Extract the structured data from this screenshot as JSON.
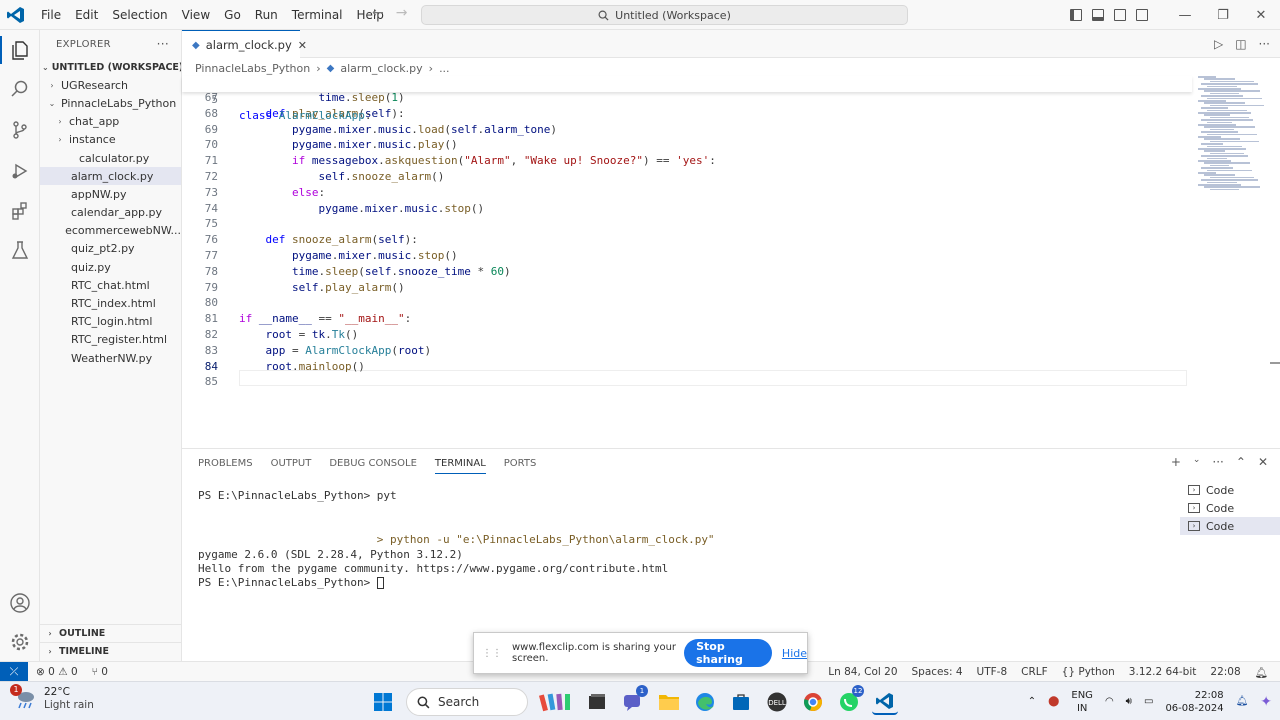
{
  "titlebar": {
    "menus": [
      "File",
      "Edit",
      "Selection",
      "View",
      "Go",
      "Run",
      "Terminal",
      "Help"
    ],
    "search_text": "Untitled (Workspace)"
  },
  "explorer": {
    "title": "EXPLORER",
    "more": "···",
    "workspace": "UNTITLED (WORKSPACE)",
    "tree": [
      {
        "label": "UGResearch",
        "indent": 1,
        "chevron": "›",
        "icon": ""
      },
      {
        "label": "PinnacleLabs_Python",
        "indent": 1,
        "chevron": "⌄",
        "icon": ""
      },
      {
        "label": "chat_app",
        "indent": 2,
        "chevron": "›",
        "icon": ""
      },
      {
        "label": "instance",
        "indent": 2,
        "chevron": "›",
        "icon": ""
      },
      {
        "label": "calculator.py",
        "indent": 3,
        "chevron": "",
        "icon": "python-file-icon"
      },
      {
        "label": "alarm_clock.py",
        "indent": 2,
        "chevron": "",
        "icon": "python-file-icon",
        "selected": true
      },
      {
        "label": "appNW.py",
        "indent": 2,
        "chevron": "",
        "icon": "python-file-icon"
      },
      {
        "label": "calendar_app.py",
        "indent": 2,
        "chevron": "",
        "icon": "python-file-icon"
      },
      {
        "label": "ecommercewebNW...",
        "indent": 2,
        "chevron": "",
        "icon": "python-file-icon"
      },
      {
        "label": "quiz_pt2.py",
        "indent": 2,
        "chevron": "",
        "icon": "python-file-icon"
      },
      {
        "label": "quiz.py",
        "indent": 2,
        "chevron": "",
        "icon": "python-file-icon"
      },
      {
        "label": "RTC_chat.html",
        "indent": 2,
        "chevron": "",
        "icon": "html-file-icon"
      },
      {
        "label": "RTC_index.html",
        "indent": 2,
        "chevron": "",
        "icon": "html-file-icon"
      },
      {
        "label": "RTC_login.html",
        "indent": 2,
        "chevron": "",
        "icon": "html-file-icon"
      },
      {
        "label": "RTC_register.html",
        "indent": 2,
        "chevron": "",
        "icon": "html-file-icon"
      },
      {
        "label": "WeatherNW.py",
        "indent": 2,
        "chevron": "",
        "icon": "python-file-icon"
      }
    ],
    "outline": "OUTLINE",
    "timeline": "TIMELINE"
  },
  "editor": {
    "tab_label": "alarm_clock.py",
    "breadcrumb": [
      "PinnacleLabs_Python",
      "alarm_clock.py",
      "..."
    ],
    "sticky": {
      "num": "5",
      "html": "<span class=\"kw\">class</span> <span class=\"cls\">AlarmClockApp</span>:"
    },
    "lines": [
      {
        "num": "67",
        "html": "            <span class=\"var\">time</span>.<span class=\"fn\">sleep</span>(<span class=\"num\">1</span>)"
      },
      {
        "num": "68",
        "html": "    <span class=\"kw\">def</span> <span class=\"fn\">play_alarm</span>(<span class=\"var\">self</span>):"
      },
      {
        "num": "69",
        "html": "        <span class=\"var\">pygame</span>.<span class=\"var\">mixer</span>.<span class=\"var\">music</span>.<span class=\"fn\">load</span>(<span class=\"var\">self</span>.<span class=\"var\">alarm_tone</span>)"
      },
      {
        "num": "70",
        "html": "        <span class=\"var\">pygame</span>.<span class=\"var\">mixer</span>.<span class=\"var\">music</span>.<span class=\"fn\">play</span>()"
      },
      {
        "num": "71",
        "html": "        <span class=\"kw2\">if</span> <span class=\"var\">messagebox</span>.<span class=\"fn\">askquestion</span>(<span class=\"str\">\"Alarm\"</span>, <span class=\"str\">\"Wake up! Snooze?\"</span>) == <span class=\"str\">'yes'</span>:"
      },
      {
        "num": "72",
        "html": "            <span class=\"var\">self</span>.<span class=\"fn\">snooze_alarm</span>()"
      },
      {
        "num": "73",
        "html": "        <span class=\"kw2\">else</span>:"
      },
      {
        "num": "74",
        "html": "            <span class=\"var\">pygame</span>.<span class=\"var\">mixer</span>.<span class=\"var\">music</span>.<span class=\"fn\">stop</span>()"
      },
      {
        "num": "75",
        "html": ""
      },
      {
        "num": "76",
        "html": "    <span class=\"kw\">def</span> <span class=\"fn\">snooze_alarm</span>(<span class=\"var\">self</span>):"
      },
      {
        "num": "77",
        "html": "        <span class=\"var\">pygame</span>.<span class=\"var\">mixer</span>.<span class=\"var\">music</span>.<span class=\"fn\">stop</span>()"
      },
      {
        "num": "78",
        "html": "        <span class=\"var\">time</span>.<span class=\"fn\">sleep</span>(<span class=\"var\">self</span>.<span class=\"var\">snooze_time</span> * <span class=\"num\">60</span>)"
      },
      {
        "num": "79",
        "html": "        <span class=\"var\">self</span>.<span class=\"fn\">play_alarm</span>()"
      },
      {
        "num": "80",
        "html": ""
      },
      {
        "num": "81",
        "html": "<span class=\"kw2\">if</span> <span class=\"var\">__name__</span> == <span class=\"str\">\"__main__\"</span>:"
      },
      {
        "num": "82",
        "html": "    <span class=\"var\">root</span> = <span class=\"var\">tk</span>.<span class=\"cls\">Tk</span>()"
      },
      {
        "num": "83",
        "html": "    <span class=\"var\">app</span> = <span class=\"cls\">AlarmClockApp</span>(<span class=\"var\">root</span>)"
      },
      {
        "num": "84",
        "html": "    <span class=\"var\">root</span>.<span class=\"fn\">mainloop</span>()",
        "active": true
      },
      {
        "num": "85",
        "html": ""
      }
    ]
  },
  "panel": {
    "tabs": [
      "PROBLEMS",
      "OUTPUT",
      "DEBUG CONSOLE",
      "TERMINAL",
      "PORTS"
    ],
    "active_tab": "TERMINAL",
    "terminal": [
      "PS E:\\PinnacleLabs_Python> pyt",
      "",
      "",
      "                           > python -u \"e:\\PinnacleLabs_Python\\alarm_clock.py\"",
      "pygame 2.6.0 (SDL 2.28.4, Python 3.12.2)",
      "Hello from the pygame community. https://www.pygame.org/contribute.html",
      "PS E:\\PinnacleLabs_Python> "
    ],
    "terminals": [
      "Code",
      "Code",
      "Code"
    ]
  },
  "statusbar": {
    "errors": "0",
    "warnings": "0",
    "ports": "0",
    "position": "Ln 84, Col 20",
    "spaces": "Spaces: 4",
    "encoding": "UTF-8",
    "eol": "CRLF",
    "language": "Python",
    "interpreter": "3.12.2 64-bit",
    "time": "22:08"
  },
  "sharing": {
    "message": "www.flexclip.com is sharing your screen.",
    "stop_label": "Stop sharing",
    "hide_label": "Hide"
  },
  "taskbar": {
    "weather_badge": "1",
    "temperature": "22°C",
    "condition": "Light rain",
    "search_label": "Search",
    "chat_badge": "1",
    "whatsapp_badge": "12",
    "lang_top": "ENG",
    "lang_bottom": "IN",
    "clock_time": "22:08",
    "clock_date": "06-08-2024"
  },
  "colors": {
    "accent": "#005fb8",
    "stop_button": "#1a73e8"
  }
}
